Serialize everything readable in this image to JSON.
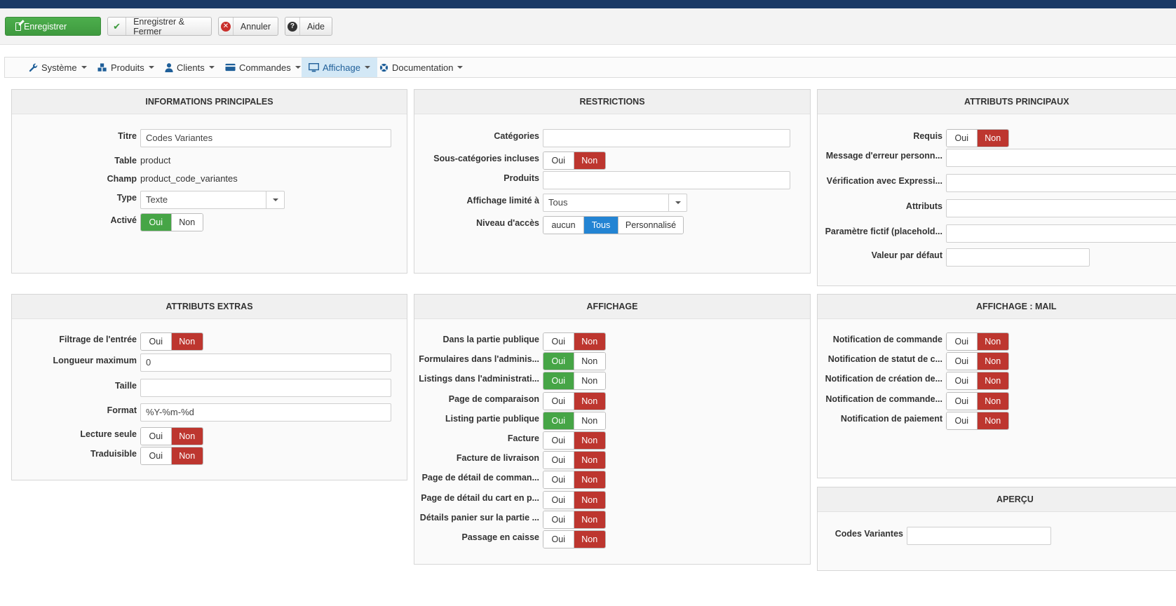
{
  "toolbar": {
    "save": "Enregistrer",
    "save_close": "Enregistrer & Fermer",
    "cancel": "Annuler",
    "help": "Aide"
  },
  "menu": [
    "Système",
    "Produits",
    "Clients",
    "Commandes",
    "Affichage",
    "Documentation"
  ],
  "active_menu": "Affichage",
  "info": {
    "title": "INFORMATIONS PRINCIPALES",
    "titre_label": "Titre",
    "titre_value": "Codes Variantes",
    "table_label": "Table",
    "table_value": "product",
    "champ_label": "Champ",
    "champ_value": "product_code_variantes",
    "type_label": "Type",
    "type_value": "Texte",
    "active_label": "Activé"
  },
  "restrictions": {
    "title": "RESTRICTIONS",
    "categories_label": "Catégories",
    "categories_value": "",
    "subcats_label": "Sous-catégories incluses",
    "produits_label": "Produits",
    "produits_value": "",
    "limited_label": "Affichage limité à",
    "limited_value": "Tous",
    "access_label": "Niveau d'accès",
    "access_options": [
      "aucun",
      "Tous",
      "Personnalisé"
    ],
    "access_selected": "Tous"
  },
  "main_attrs": {
    "title": "ATTRIBUTS PRINCIPAUX",
    "requis_label": "Requis",
    "error_msg_label": "Message d'erreur personn...",
    "regex_label": "Vérification avec Expressi...",
    "attributs_label": "Attributs",
    "placeholder_label": "Paramètre fictif (placehold...",
    "default_label": "Valeur par défaut"
  },
  "extras": {
    "title": "ATTRIBUTS EXTRAS",
    "filter_label": "Filtrage de l'entrée",
    "maxlen_label": "Longueur maximum",
    "maxlen_value": "0",
    "size_label": "Taille",
    "size_value": "",
    "format_label": "Format",
    "format_value": "%Y-%m-%d",
    "readonly_label": "Lecture seule",
    "translatable_label": "Traduisible"
  },
  "display": {
    "title": "AFFICHAGE",
    "items": [
      {
        "label": "Dans la partie publique",
        "value": "Non"
      },
      {
        "label": "Formulaires dans l'adminis...",
        "value": "Oui"
      },
      {
        "label": "Listings dans l'administrati...",
        "value": "Oui"
      },
      {
        "label": "Page de comparaison",
        "value": "Non"
      },
      {
        "label": "Listing partie publique",
        "value": "Oui"
      },
      {
        "label": "Facture",
        "value": "Non"
      },
      {
        "label": "Facture de livraison",
        "value": "Non"
      },
      {
        "label": "Page de détail de comman...",
        "value": "Non"
      },
      {
        "label": "Page de détail du cart en p...",
        "value": "Non"
      },
      {
        "label": "Détails panier sur la partie ...",
        "value": "Non"
      },
      {
        "label": "Passage en caisse",
        "value": "Non"
      }
    ]
  },
  "mail": {
    "title": "AFFICHAGE : MAIL",
    "items": [
      {
        "label": "Notification de commande",
        "value": "Non"
      },
      {
        "label": "Notification de statut de c...",
        "value": "Non"
      },
      {
        "label": "Notification de création de...",
        "value": "Non"
      },
      {
        "label": "Notification de commande...",
        "value": "Non"
      },
      {
        "label": "Notification de paiement",
        "value": "Non"
      }
    ]
  },
  "preview": {
    "title": "APERÇU",
    "label": "Codes Variantes",
    "value": ""
  },
  "toggle": {
    "yes": "Oui",
    "no": "Non"
  },
  "toggle_values": {
    "active": "Oui",
    "subcats": "Non",
    "requis": "Non",
    "filter": "Non",
    "readonly": "Non",
    "translatable": "Non"
  },
  "colors": {
    "green": "#46a546",
    "red": "#bd362f",
    "blue": "#2384d3",
    "active_menu_bg": "#d3e8f6"
  }
}
